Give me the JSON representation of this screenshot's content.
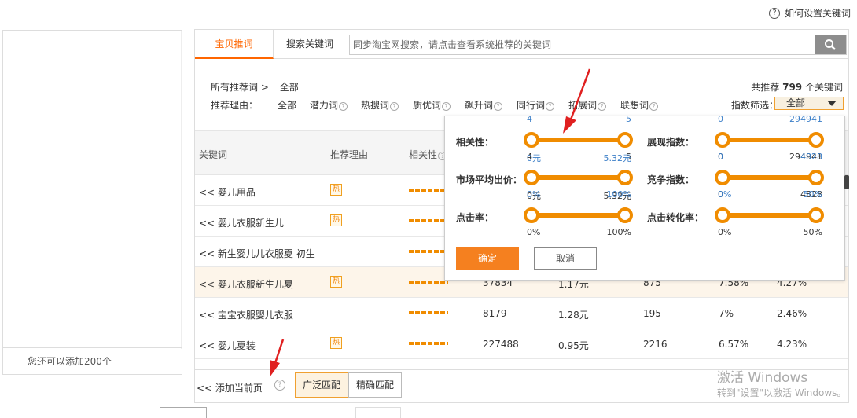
{
  "help": {
    "icon": "question-circle-icon",
    "label": "如何设置关键词"
  },
  "left_panel": {
    "footer_text": "您还可以添加200个"
  },
  "tabs": [
    {
      "label": "宝贝推词",
      "active": true
    },
    {
      "label": "搜索关键词",
      "active": false
    }
  ],
  "search": {
    "placeholder": "同步淘宝网搜索，请点击查看系统推荐的关键词",
    "button_icon": "search-icon"
  },
  "breadcrumb": {
    "root": "所有推荐词 >",
    "current": "全部"
  },
  "reasons": {
    "label": "推荐理由：",
    "items": [
      "全部",
      "潜力词",
      "热搜词",
      "质优词",
      "飙升词",
      "同行词",
      "拓展词",
      "联想词"
    ]
  },
  "total": {
    "prefix": "共推荐",
    "count": "799",
    "suffix": "个关键词"
  },
  "index_filter": {
    "label": "指数筛选：",
    "value": "全部"
  },
  "table": {
    "headers": [
      "关键词",
      "推荐理由",
      "相关性"
    ],
    "rows": [
      {
        "keyword": "<< 婴儿用品",
        "hot": true,
        "vals": [
          "",
          "",
          "",
          "",
          ""
        ]
      },
      {
        "keyword": "<< 婴儿衣服新生儿",
        "hot": true,
        "vals": [
          "",
          "",
          "",
          "",
          ""
        ]
      },
      {
        "keyword": "<< 新生婴儿儿衣服夏 初生",
        "hot": false,
        "vals": [
          "",
          "",
          "",
          "",
          ""
        ]
      },
      {
        "keyword": "<< 婴儿衣服新生儿夏",
        "hot": true,
        "vals": [
          "37834",
          "1.17元",
          "875",
          "7.58%",
          "4.27%"
        ]
      },
      {
        "keyword": "<< 宝宝衣服婴儿衣服",
        "hot": false,
        "vals": [
          "8179",
          "1.28元",
          "195",
          "7%",
          "2.46%"
        ]
      },
      {
        "keyword": "<< 婴儿夏装",
        "hot": true,
        "vals": [
          "227488",
          "0.95元",
          "2216",
          "6.57%",
          "4.23%"
        ]
      }
    ],
    "hot_label": "热"
  },
  "bottom": {
    "add_page": "<< 添加当前页",
    "broad_match": "广泛匹配",
    "exact_match": "精确匹配"
  },
  "popup": {
    "sliders": [
      {
        "label": "相关性：",
        "min_top": "4",
        "max_top": "5",
        "min_bot": "4",
        "max_bot": "5"
      },
      {
        "label": "展现指数：",
        "min_top": "0",
        "max_top": "294941",
        "min_bot": "0",
        "max_bot": "294941"
      },
      {
        "label": "市场平均出价：",
        "min_top": "0元",
        "max_top": "5.32元",
        "min_bot": "0元",
        "max_bot": "5.32元"
      },
      {
        "label": "竞争指数：",
        "min_top": "0",
        "max_top": "4828",
        "min_bot": "0",
        "max_bot": "4828"
      },
      {
        "label": "点击率：",
        "min_top": "0%",
        "max_top": "100%",
        "min_bot": "0%",
        "max_bot": "100%"
      },
      {
        "label": "点击转化率：",
        "min_top": "0%",
        "max_top": "50%",
        "min_bot": "0%",
        "max_bot": "50%"
      }
    ],
    "ok_label": "确定",
    "cancel_label": "取消"
  },
  "watermark": {
    "line1": "激活 Windows",
    "line2": "转到\"设置\"以激活 Windows。"
  },
  "colors": {
    "accent": "#f08c00",
    "link_blue": "#3c7fc8",
    "annotation_arrow": "#e02020"
  }
}
